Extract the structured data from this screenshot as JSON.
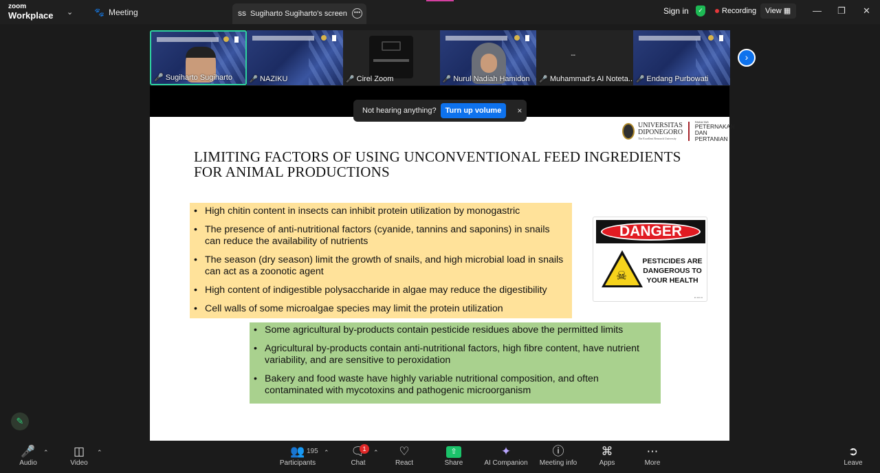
{
  "app": {
    "logo_line1": "zoom",
    "logo_line2": "Workplace",
    "meeting_tab": "Meeting",
    "screen_tab_badge": "SS",
    "screen_tab_title": "Sugiharto Sugiharto's screen",
    "sign_in": "Sign in",
    "recording": "Recording",
    "view": "View"
  },
  "participants_strip": [
    {
      "name": "Sugiharto Sugiharto",
      "active": true
    },
    {
      "name": "NAZIKU"
    },
    {
      "name": "Cirel Zoom"
    },
    {
      "name": "Nurul Nadiah Hamidon"
    },
    {
      "name": "Muhammad's AI Noteta..."
    },
    {
      "name": "Endang Purbowati"
    }
  ],
  "toast": {
    "message": "Not hearing anything?",
    "button": "Turn up volume",
    "close": "×"
  },
  "slide": {
    "logo": {
      "univ": "UNIVERSITAS",
      "univ2": "DIPONEGORO",
      "tagline": "The Excellent Research University",
      "fakultas": "FAKULTAS",
      "fak1": "PETERNAKAN",
      "fak2": "DAN PERTANIAN"
    },
    "title_line1": "Limiting factors of using unconventional feed ingredients",
    "title_line2": "for animal productions",
    "yellow_bullets": [
      "High chitin content in insects can inhibit protein utilization by monogastric",
      "The presence of anti-nutritional factors (cyanide, tannins and saponins) in snails can reduce the availability of nutrients",
      "The season (dry season) limit the growth of snails, and high microbial load in snails can act as a zoonotic agent",
      "High content of indigestible polysaccharide in algae may reduce the digestibility",
      "Cell walls of some microalgae species may limit the protein utilization"
    ],
    "green_bullets": [
      "Some agricultural by-products contain pesticide residues above the permitted limits",
      "Agricultural by-products contain anti-nutritional factors, high fibre content, have nutrient variability, and are sensitive to peroxidation",
      "Bakery and food waste have highly variable nutritional composition, and often contaminated with mycotoxins and pathogenic microorganism"
    ],
    "danger_sign": {
      "header": "DANGER",
      "text_line1": "PESTICIDES ARE",
      "text_line2": "DANGEROUS TO",
      "text_line3": "YOUR HEALTH"
    }
  },
  "toolbar": {
    "audio": "Audio",
    "video": "Video",
    "participants": "Participants",
    "participants_count": "195",
    "chat": "Chat",
    "chat_badge": "1",
    "react": "React",
    "share": "Share",
    "ai_companion": "AI Companion",
    "meeting_info": "Meeting info",
    "apps": "Apps",
    "more": "More",
    "leave": "Leave"
  },
  "colors": {
    "accent_blue": "#0e72ed",
    "share_green": "#1bc36a",
    "active_border": "#2ed3a0",
    "yellow_box": "#ffe29a",
    "green_box": "#a9d18e",
    "danger_red": "#e11b22"
  }
}
